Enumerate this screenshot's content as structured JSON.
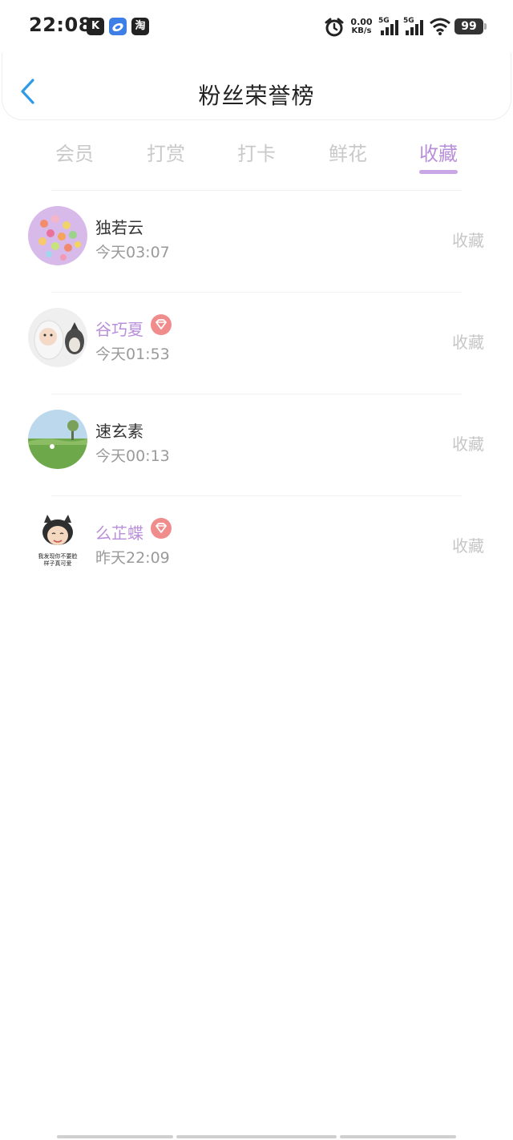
{
  "status_bar": {
    "time": "22:08",
    "apps": [
      {
        "icon": "k-app-icon",
        "label": "K",
        "color": "#222222"
      },
      {
        "icon": "cloud-app-icon",
        "label": "",
        "color": "#3d7fe6"
      },
      {
        "icon": "taobao-app-icon",
        "label": "淘",
        "color": "#222222"
      }
    ],
    "net_speed_value": "0.00",
    "net_speed_unit": "KB/s",
    "signal1_label": "5G",
    "signal2_label": "5G",
    "battery": "99"
  },
  "header": {
    "title": "粉丝荣誉榜",
    "back_icon": "chevron-left-icon"
  },
  "tabs": [
    {
      "label": "会员",
      "active": false
    },
    {
      "label": "打赏",
      "active": false
    },
    {
      "label": "打卡",
      "active": false
    },
    {
      "label": "鲜花",
      "active": false
    },
    {
      "label": "收藏",
      "active": true
    }
  ],
  "accent_color": "#b98fd9",
  "fans": [
    {
      "name": "独若云",
      "time": "今天03:07",
      "action": "收藏",
      "vip": false,
      "avatar": "candy-avatar"
    },
    {
      "name": "谷巧夏",
      "time": "今天01:53",
      "action": "收藏",
      "vip": true,
      "avatar": "baby-dog-avatar"
    },
    {
      "name": "速玄素",
      "time": "今天00:13",
      "action": "收藏",
      "vip": false,
      "avatar": "landscape-avatar"
    },
    {
      "name": "么芷蝶",
      "time": "昨天22:09",
      "action": "收藏",
      "vip": true,
      "avatar": "cat-girl-avatar",
      "avatar_text": "我发现你不要脸 样子真可爱"
    }
  ]
}
